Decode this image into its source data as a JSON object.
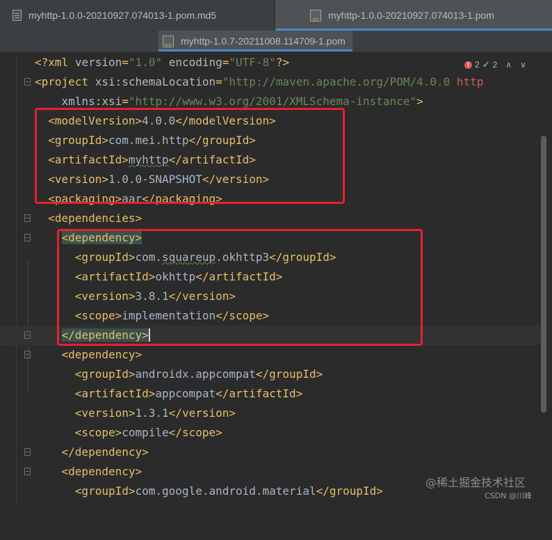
{
  "tabs": {
    "row1": [
      {
        "label": "myhttp-1.0.0-20210927.074013-1.pom.md5",
        "icon": "text-file-icon"
      },
      {
        "label": "myhttp-1.0.0-20210927.074013-1.pom",
        "icon": "xml-file-icon"
      }
    ],
    "row2": [
      {
        "label": "myhttp-1.0.7-20211008.114709-1.pom",
        "icon": "xml-file-icon"
      }
    ]
  },
  "inspections": {
    "errors": "2",
    "ok_count": "2",
    "error_color": "#e05555",
    "ok_color": "#5fb860"
  },
  "code": {
    "xml_decl": {
      "open": "<?",
      "tag": "xml",
      "attr1": "version",
      "eq1": "=",
      "val1": "\"1.0\"",
      "attr2": "encoding",
      "eq2": "=",
      "val2": "\"UTF-8\"",
      "close": "?>"
    },
    "project": {
      "open": "<",
      "tag": "project",
      "ns": "xsi",
      "colon": ":",
      "attr": "schemaLocation",
      "eq": "=",
      "val": "\"http://maven.apache.org/POM/4.0.0 ",
      "val_tail": "http"
    },
    "xmlns": {
      "ns": "xmlns",
      "colon": ":",
      "attr": "xsi",
      "eq": "=",
      "val": "\"http://www.w3.org/2001/XMLSchema-instance\"",
      "close": ">"
    },
    "modelVersion": {
      "open": "<modelVersion>",
      "value": "4.0.0",
      "close": "</modelVersion>"
    },
    "groupId": {
      "open": "<groupId>",
      "value": "com.mei.http",
      "close": "</groupId>"
    },
    "artifactId": {
      "open": "<artifactId>",
      "value": "myhttp",
      "close": "</artifactId>"
    },
    "version": {
      "open": "<version>",
      "value": "1.0.0-SNAPSHOT",
      "close": "</version>"
    },
    "packaging": {
      "open": "<packaging>",
      "value": "aar",
      "close": "</packaging>"
    },
    "dependencies_open": "<dependencies>",
    "dep1": {
      "open": "<dependency>",
      "groupId": {
        "open": "<groupId>",
        "value_a": "com.",
        "value_b": "squareup",
        "value_c": ".okhttp3",
        "close": "</groupId>"
      },
      "artifactId": {
        "open": "<artifactId>",
        "value": "okhttp",
        "close": "</artifactId>"
      },
      "version": {
        "open": "<version>",
        "value": "3.8.1",
        "close": "</version>"
      },
      "scope": {
        "open": "<scope>",
        "value": "implementation",
        "close": "</scope>"
      },
      "close": "</dependency>"
    },
    "dep2": {
      "open": "<dependency>",
      "groupId": {
        "open": "<groupId>",
        "value": "androidx.appcompat",
        "close": "</groupId>"
      },
      "artifactId": {
        "open": "<artifactId>",
        "value": "appcompat",
        "close": "</artifactId>"
      },
      "version": {
        "open": "<version>",
        "value": "1.3.1",
        "close": "</version>"
      },
      "scope": {
        "open": "<scope>",
        "value": "compile",
        "close": "</scope>"
      },
      "close": "</dependency>"
    },
    "dep3": {
      "open": "<dependency>",
      "groupId": {
        "open": "<groupId>",
        "value": "com.google.android.material",
        "close": "</groupId>"
      }
    }
  },
  "watermark": {
    "main": "@稀土掘金技术社区",
    "sub": "CSDN @川峰"
  }
}
